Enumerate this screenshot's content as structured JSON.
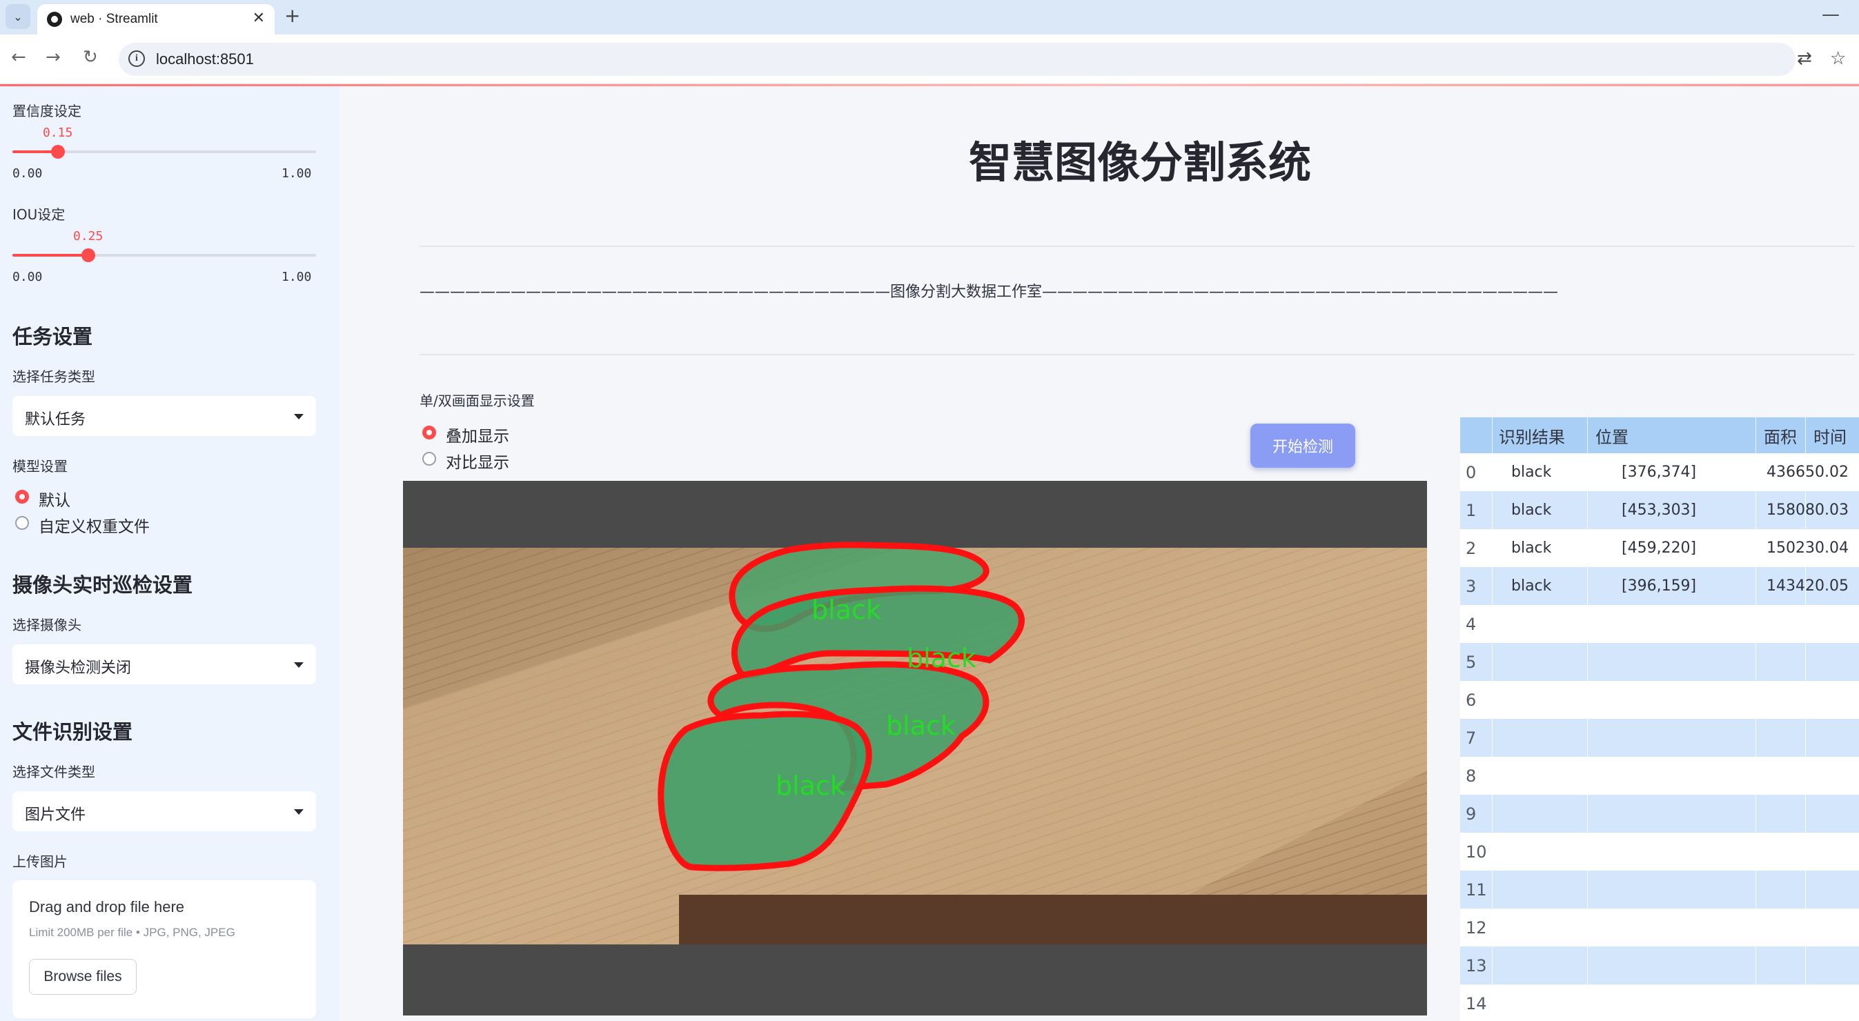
{
  "browser": {
    "tab_title": "web · Streamlit",
    "url": "localhost:8501"
  },
  "sidebar": {
    "conf": {
      "label": "置信度设定",
      "value": "0.15",
      "min": "0.00",
      "max": "1.00",
      "fraction": 0.15
    },
    "iou": {
      "label": "IOU设定",
      "value": "0.25",
      "min": "0.00",
      "max": "1.00",
      "fraction": 0.25
    },
    "task": {
      "heading": "任务设置",
      "label": "选择任务类型",
      "selected": "默认任务"
    },
    "model": {
      "label": "模型设置",
      "options": [
        "默认",
        "自定义权重文件"
      ],
      "selected_index": 0
    },
    "camera": {
      "heading": "摄像头实时巡检设置",
      "label": "选择摄像头",
      "selected": "摄像头检测关闭"
    },
    "file": {
      "heading": "文件识别设置",
      "label": "选择文件类型",
      "selected": "图片文件"
    },
    "upload": {
      "label": "上传图片",
      "title": "Drag and drop file here",
      "limit": "Limit 200MB per file • JPG, PNG, JPEG",
      "button": "Browse files"
    }
  },
  "main": {
    "title": "智慧图像分割系统",
    "subtitle": "———————————————————————————————图像分割大数据工作室——————————————————————————————————",
    "display_label": "单/双画面显示设置",
    "display_options": [
      "叠加显示",
      "对比显示"
    ],
    "display_selected": 0,
    "start_button": "开始检测",
    "image_labels": [
      "black",
      "black",
      "black",
      "black"
    ]
  },
  "table": {
    "columns": [
      "",
      "识别结果",
      "位置",
      "面积",
      "时间"
    ],
    "rows": [
      {
        "idx": "0",
        "result": "black",
        "pos": "[376,374]",
        "area": "43665",
        "time": "0.02"
      },
      {
        "idx": "1",
        "result": "black",
        "pos": "[453,303]",
        "area": "15808",
        "time": "0.03"
      },
      {
        "idx": "2",
        "result": "black",
        "pos": "[459,220]",
        "area": "15023",
        "time": "0.04"
      },
      {
        "idx": "3",
        "result": "black",
        "pos": "[396,159]",
        "area": "14342",
        "time": "0.05"
      },
      {
        "idx": "4",
        "result": "",
        "pos": "",
        "area": "",
        "time": ""
      },
      {
        "idx": "5",
        "result": "",
        "pos": "",
        "area": "",
        "time": ""
      },
      {
        "idx": "6",
        "result": "",
        "pos": "",
        "area": "",
        "time": ""
      },
      {
        "idx": "7",
        "result": "",
        "pos": "",
        "area": "",
        "time": ""
      },
      {
        "idx": "8",
        "result": "",
        "pos": "",
        "area": "",
        "time": ""
      },
      {
        "idx": "9",
        "result": "",
        "pos": "",
        "area": "",
        "time": ""
      },
      {
        "idx": "10",
        "result": "",
        "pos": "",
        "area": "",
        "time": ""
      },
      {
        "idx": "11",
        "result": "",
        "pos": "",
        "area": "",
        "time": ""
      },
      {
        "idx": "12",
        "result": "",
        "pos": "",
        "area": "",
        "time": ""
      },
      {
        "idx": "13",
        "result": "",
        "pos": "",
        "area": "",
        "time": ""
      },
      {
        "idx": "14",
        "result": "",
        "pos": "",
        "area": "",
        "time": ""
      }
    ]
  },
  "colors": {
    "accent": "#ff4b4b",
    "button": "#8b9cf5",
    "mask": "#3fa86a",
    "outline": "#ff0000",
    "label": "#22dd22"
  }
}
